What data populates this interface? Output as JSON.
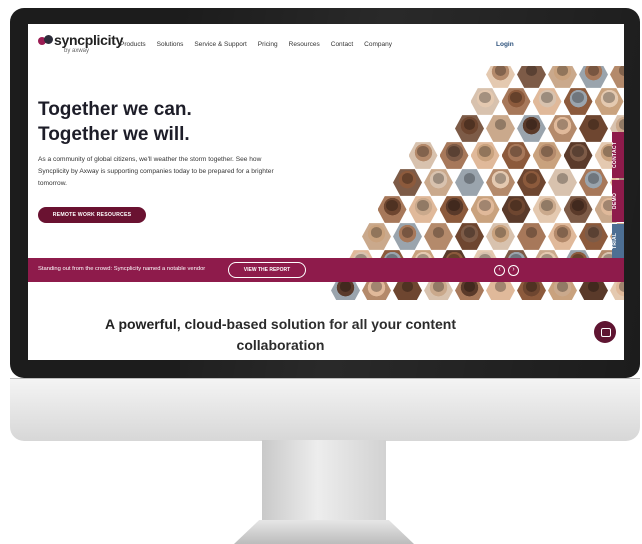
{
  "brand": {
    "name": "syncplicity",
    "tagline": "by axway"
  },
  "nav": {
    "items": [
      "Products",
      "Solutions",
      "Service & Support",
      "Pricing",
      "Resources",
      "Contact",
      "Company"
    ],
    "login": "Login"
  },
  "hero": {
    "headline_line1": "Together we can.",
    "headline_line2": "Together we will.",
    "description": "As a community of global citizens, we'll weather the storm together. See how Syncplicity by Axway is supporting companies today to be prepared for a brighter tomorrow.",
    "cta": "REMOTE WORK RESOURCES"
  },
  "side_tabs": [
    "CONTACT",
    "DEMO",
    "TRIAL"
  ],
  "banner": {
    "text": "Standing out from the crowd: Syncplicity named a notable vendor",
    "button": "VIEW THE REPORT"
  },
  "section": {
    "title_line1": "A powerful, cloud-based solution for all your content",
    "title_line2": "collaboration"
  },
  "colors": {
    "brand_maroon": "#8e1b4b",
    "cta_dark": "#6a1231",
    "heading": "#1d1d28"
  },
  "icons": [
    "logo-mark-icon",
    "chevron-left-icon",
    "chevron-right-icon",
    "chat-bubble-icon"
  ]
}
